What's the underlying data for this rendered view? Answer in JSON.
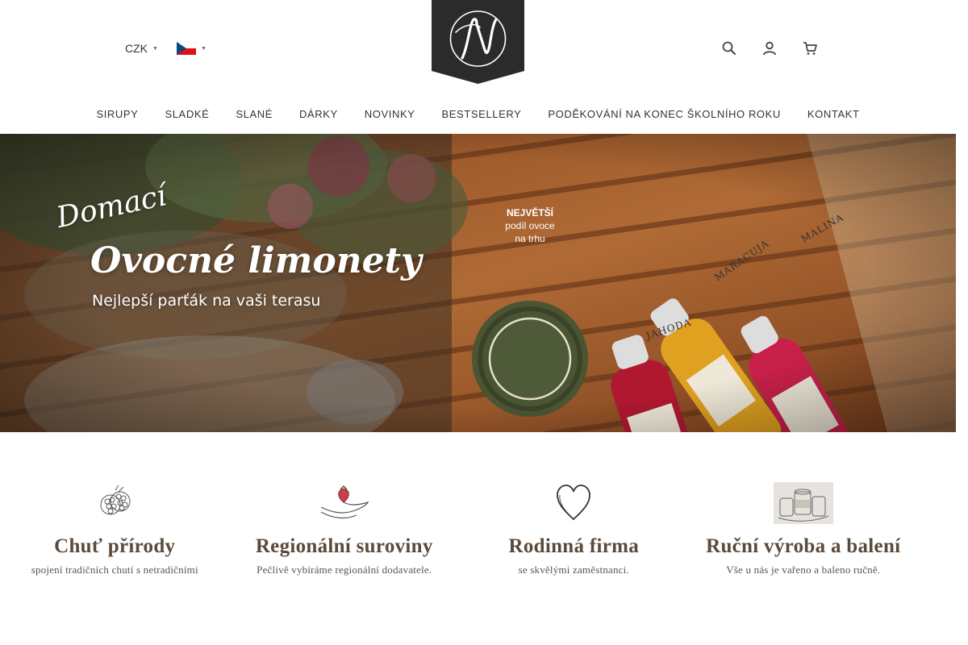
{
  "header": {
    "currency": "CZK",
    "language": "cs",
    "logo_letter": "N",
    "icons": [
      "search-icon",
      "user-icon",
      "cart-icon"
    ],
    "cart_count": "0"
  },
  "nav": {
    "items": [
      {
        "label": "SIRUPY"
      },
      {
        "label": "SLADKÉ"
      },
      {
        "label": "SLANÉ"
      },
      {
        "label": "DÁRKY"
      },
      {
        "label": "NOVINKY"
      },
      {
        "label": "BESTSELLERY"
      },
      {
        "label": "PODĚKOVÁNÍ NA KONEC ŠKOLNÍHO ROKU"
      },
      {
        "label": "KONTAKT"
      }
    ]
  },
  "hero": {
    "kicker": "Domací",
    "title": "Ovocné limonety",
    "subtitle": "Nejlepší parťák na vaši terasu",
    "seal_line1": "NEJVĚTŠÍ",
    "seal_line2": "podíl ovoce",
    "seal_line3": "na trhu",
    "bottle_labels": [
      "MALINA",
      "MARACUJA",
      "JAHODA"
    ]
  },
  "features": [
    {
      "icon": "raspberry-icon",
      "title": "Chuť přírody",
      "text": "spojení tradičních chutí s netradičními"
    },
    {
      "icon": "hand-strawberry-icon",
      "title": "Regionální suroviny",
      "text": "Pečlivě vybíráme regionální dodavatele."
    },
    {
      "icon": "heart-icon",
      "title": "Rodinná firma",
      "text": "se skvělými zaměstnanci."
    },
    {
      "icon": "jars-icon",
      "title": "Ruční výroba a balení",
      "text": "Vše u nás je vařeno a baleno ručně."
    }
  ],
  "colors": {
    "logo_bg": "#2b2b2b",
    "heading": "#5a4a3a",
    "seal": "#4a5534"
  }
}
